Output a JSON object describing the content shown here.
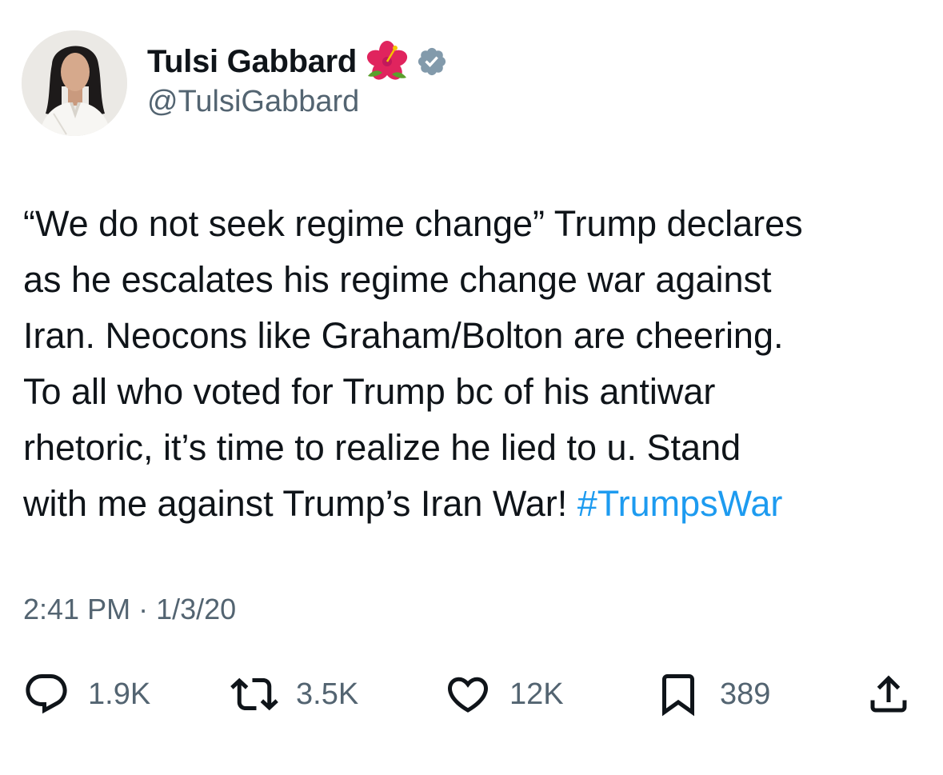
{
  "profile": {
    "display_name": "Tulsi Gabbard",
    "handle": "@TulsiGabbard",
    "name_emoji_icon": "hibiscus-flower-icon",
    "verified_icon": "verified-badge-icon",
    "verified_color": "#829aab"
  },
  "tweet": {
    "lines": [
      "“We do not seek regime change” Trump declares",
      "as he escalates his regime change war against",
      "Iran. Neocons like Graham/Bolton are cheering.",
      "To all who voted for Trump bc of his antiwar",
      "rhetoric, it’s time to realize he lied to u. Stand",
      "with me against Trump’s Iran War! "
    ],
    "hashtag": "#TrumpsWar",
    "hashtag_color": "#1d9bf0"
  },
  "meta": {
    "time": "2:41 PM",
    "separator": " · ",
    "date": "1/3/20"
  },
  "actions": {
    "replies": {
      "icon": "reply-icon",
      "count": "1.9K"
    },
    "reposts": {
      "icon": "repost-icon",
      "count": "3.5K"
    },
    "likes": {
      "icon": "heart-icon",
      "count": "12K"
    },
    "bookmarks": {
      "icon": "bookmark-icon",
      "count": "389"
    },
    "share": {
      "icon": "share-icon"
    }
  },
  "colors": {
    "text_primary": "#0f1419",
    "text_secondary": "#536471",
    "background": "#ffffff"
  }
}
